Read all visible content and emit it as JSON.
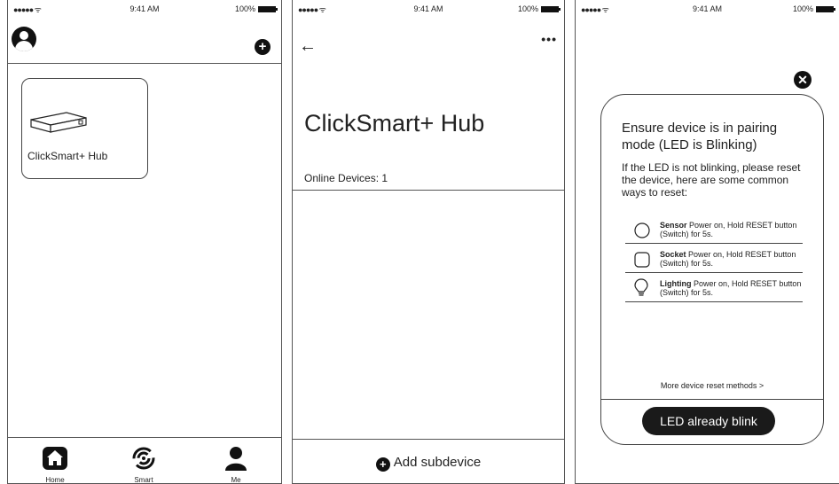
{
  "status": {
    "signal": "●●●●● ᯤ",
    "time": "9:41 AM",
    "battery": "100%"
  },
  "home": {
    "device_card_label": "ClickSmart+ Hub",
    "tabs": [
      {
        "label": "Home",
        "icon": "home-icon"
      },
      {
        "label": "Smart",
        "icon": "smart-icon"
      },
      {
        "label": "Me",
        "icon": "user-icon"
      }
    ]
  },
  "hub": {
    "back": "←",
    "more": "•••",
    "title": "ClickSmart+ Hub",
    "online": "Online Devices: 1",
    "add_label": "Add subdevice"
  },
  "pairing": {
    "close": "✕",
    "title": "Ensure device is in pairing mode (LED is Blinking)",
    "desc": "If the LED is not blinking, please reset the device, here are some common ways to reset:",
    "items": [
      {
        "name": "Sensor",
        "text": " Power on, Hold RESET button (Switch) for 5s.",
        "icon": "sensor-icon"
      },
      {
        "name": "Socket",
        "text": " Power on, Hold RESET button (Switch) for 5s.",
        "icon": "socket-icon"
      },
      {
        "name": "Lighting",
        "text": " Power on, Hold RESET button (Switch) for 5s.",
        "icon": "bulb-icon"
      }
    ],
    "more_methods": "More device reset methods >",
    "button": "LED already blink"
  }
}
